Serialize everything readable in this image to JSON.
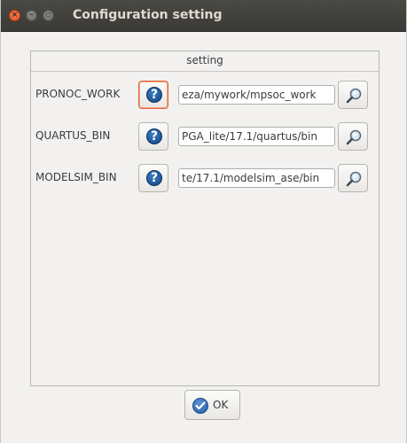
{
  "window": {
    "title": "Configuration setting",
    "controls": {
      "close": "×",
      "minimize": "–",
      "maximize": "▫"
    }
  },
  "group": {
    "legend": "setting"
  },
  "rows": [
    {
      "label": "PRONOC_WORK",
      "help_icon": "question-icon",
      "value": "eza/mywork/mpsoc_work",
      "browse_icon": "magnifier-icon",
      "focused": true
    },
    {
      "label": "QUARTUS_BIN",
      "help_icon": "question-icon",
      "value": "PGA_lite/17.1/quartus/bin",
      "browse_icon": "magnifier-icon",
      "focused": false
    },
    {
      "label": "MODELSIM_BIN",
      "help_icon": "question-icon",
      "value": "te/17.1/modelsim_ase/bin",
      "browse_icon": "magnifier-icon",
      "focused": false
    }
  ],
  "help_glyph": "?",
  "ok_button": {
    "label": "OK",
    "icon": "check-icon"
  },
  "colors": {
    "titlebar": "#3b3a36",
    "focus": "#e06336",
    "help": "#13467f"
  }
}
